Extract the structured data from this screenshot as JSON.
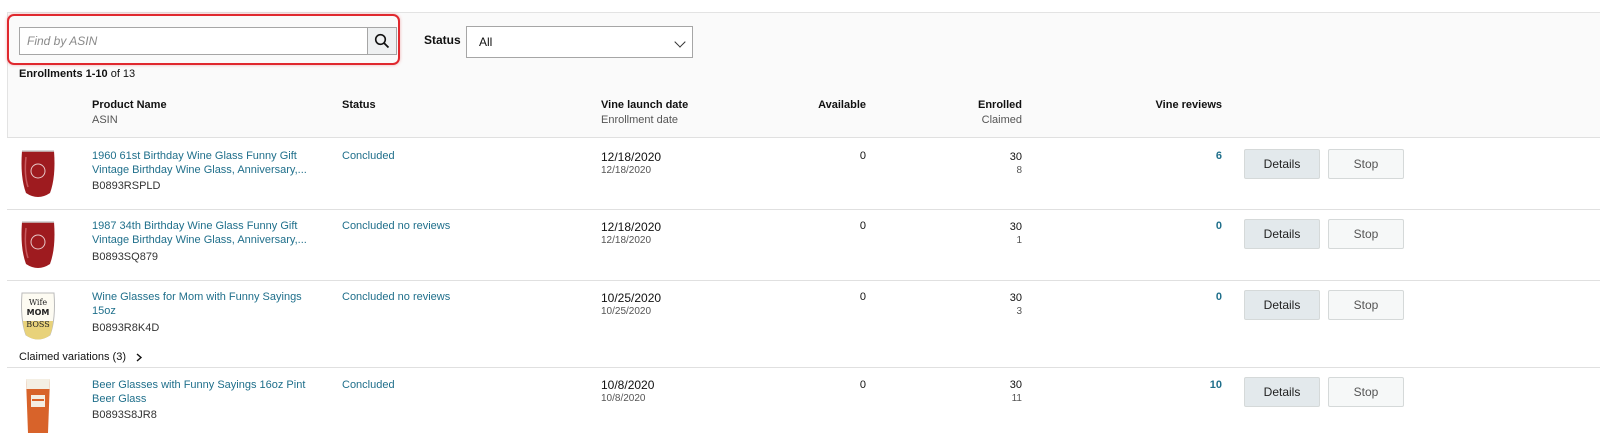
{
  "search": {
    "placeholder": "Find by ASIN"
  },
  "filter": {
    "label": "Status",
    "value": "All"
  },
  "summary": {
    "range": "Enrollments 1-10",
    "total": "of 13"
  },
  "columns": {
    "product": "Product Name",
    "asin": "ASIN",
    "status": "Status",
    "launch": "Vine launch date",
    "enrollment_date": "Enrollment date",
    "available": "Available",
    "enrolled": "Enrolled",
    "claimed": "Claimed",
    "reviews": "Vine reviews"
  },
  "actions": {
    "details": "Details",
    "stop": "Stop"
  },
  "rows": [
    {
      "name_line1": "1960 61st Birthday Wine Glass Funny Gift",
      "name_line2": "Vintage Birthday Wine Glass, Anniversary,...",
      "asin": "B0893RSPLD",
      "status": "Concluded",
      "launch": "12/18/2020",
      "enrolled_date": "12/18/2020",
      "available": "0",
      "enrolled": "30",
      "claimed": "8",
      "reviews": "6"
    },
    {
      "name_line1": "1987 34th Birthday Wine Glass Funny Gift",
      "name_line2": "Vintage Birthday Wine Glass, Anniversary,...",
      "asin": "B0893SQ879",
      "status": "Concluded no reviews",
      "launch": "12/18/2020",
      "enrolled_date": "12/18/2020",
      "available": "0",
      "enrolled": "30",
      "claimed": "1",
      "reviews": "0"
    },
    {
      "name_line1": "Wine Glasses for Mom with Funny Sayings",
      "name_line2": "15oz",
      "asin": "B0893R8K4D",
      "status": "Concluded no reviews",
      "launch": "10/25/2020",
      "enrolled_date": "10/25/2020",
      "available": "0",
      "enrolled": "30",
      "claimed": "3",
      "reviews": "0"
    },
    {
      "name_line1": "Beer Glasses with Funny Sayings 16oz Pint",
      "name_line2": "Beer Glass",
      "asin": "B0893S8JR8",
      "status": "Concluded",
      "launch": "10/8/2020",
      "enrolled_date": "10/8/2020",
      "available": "0",
      "enrolled": "30",
      "claimed": "11",
      "reviews": "10"
    }
  ],
  "variations": {
    "label": "Claimed variations (3)"
  },
  "thumb_text": {
    "line1": "Wife",
    "line2": "MOM",
    "line3": "BOSS"
  },
  "colors": {
    "link": "#1f6f8b",
    "highlight": "#e0282e",
    "wine": "#9e1b1f"
  }
}
